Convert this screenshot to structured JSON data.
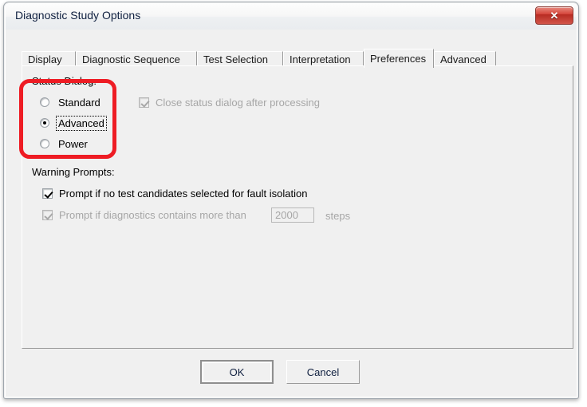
{
  "window": {
    "title": "Diagnostic Study Options",
    "close_icon": "close-icon",
    "close_glyph": "✕"
  },
  "tabs": [
    {
      "label": "Display",
      "active": false
    },
    {
      "label": "Diagnostic Sequence",
      "active": false
    },
    {
      "label": "Test Selection",
      "active": false
    },
    {
      "label": "Interpretation",
      "active": false
    },
    {
      "label": "Preferences",
      "active": true
    },
    {
      "label": "Advanced",
      "active": false
    }
  ],
  "preferences": {
    "status_dialog": {
      "label": "Status Dialog:",
      "options": [
        {
          "label": "Standard",
          "checked": false,
          "focused": false
        },
        {
          "label": "Advanced",
          "checked": true,
          "focused": true
        },
        {
          "label": "Power",
          "checked": false,
          "focused": false
        }
      ]
    },
    "close_status_dialog": {
      "label": "Close status dialog after processing",
      "checked": true,
      "enabled": false
    },
    "warning_prompts": {
      "label": "Warning Prompts:",
      "prompt_no_candidates": {
        "label": "Prompt if no test candidates selected for fault isolation",
        "checked": true,
        "enabled": true
      },
      "prompt_max_steps": {
        "label": "Prompt if diagnostics contains more than",
        "checked": true,
        "enabled": false,
        "value": "2000",
        "unit": "steps"
      }
    }
  },
  "footer": {
    "ok_label": "OK",
    "cancel_label": "Cancel"
  },
  "annotation": {
    "color": "#ee1c24",
    "target": "status-dialog-group"
  }
}
